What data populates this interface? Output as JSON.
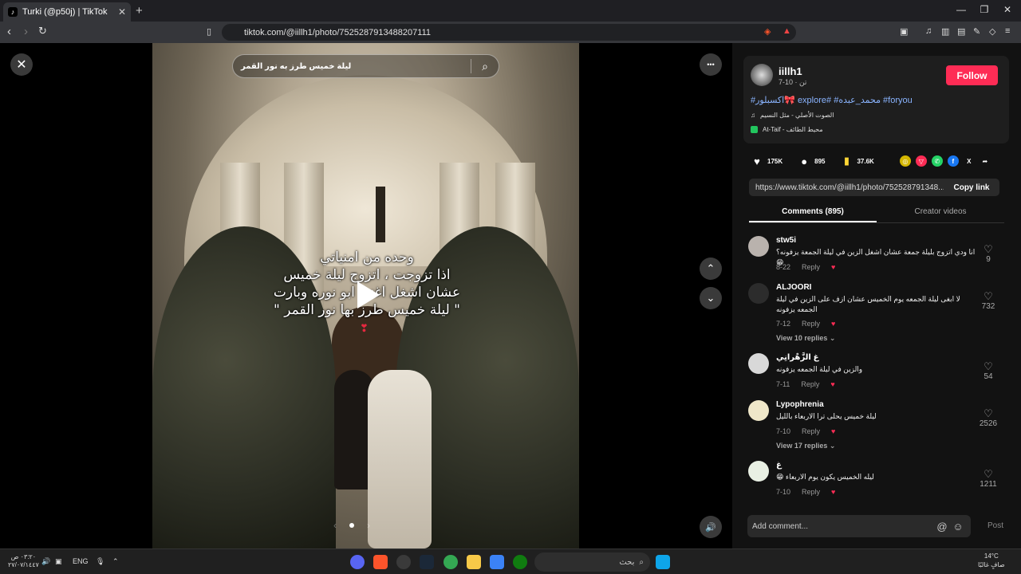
{
  "browser": {
    "tab_title": "Turki (@p50j) | TikTok",
    "tab_close": "✕",
    "new_tab": "+",
    "url": "tiktok.com/@iillh1/photo/7525287913488207111",
    "win_min": "—",
    "win_max": "❐",
    "win_close": "✕"
  },
  "viewer": {
    "search_text": "ليلة خميس طرز به نور القمر",
    "caption": "وحده من امنياتي\nاذا تزوجت ، اتزوج ليلة خميس\nعشان اشغل اغنية ابو نوره وبارت\n\" ليلة خميس طرز بها نور القمر \"",
    "heart": "❣",
    "icons": {
      "close": "✕",
      "search": "⌕",
      "more": "•••",
      "up": "⌃",
      "down": "⌄",
      "mute": "🔊",
      "prev": "‹",
      "next": "›"
    }
  },
  "post": {
    "username": "iillh1",
    "meta": "7-10 · تن",
    "follow_label": "Follow",
    "hashtags": "#اكسبلور🎀 explore# #محمد_عبده #foryou",
    "sound": "الصوت الأصلي - مثل النسيم",
    "location": "At-Taif - محيط الطائف",
    "likes": "175K",
    "comments_count": "895",
    "saves": "37.6K",
    "link": "https://www.tiktok.com/@iillh1/photo/752528791348...",
    "copy_link": "Copy link"
  },
  "tabs": {
    "comments": "Comments (895)",
    "creator": "Creator videos"
  },
  "comments": [
    {
      "user": "stw5i",
      "text": "انا ودي اتزوج بليلة جمعة عشان اشغل الزين في ليلة الجمعة يزفونه؟😁",
      "date": "8-22",
      "reply": "Reply",
      "likes": "9",
      "replies": ""
    },
    {
      "user": "ALJOORI",
      "text": "لا ابغى ليلة الجمعه يوم الخميس عشان ازف على الزين في ليلة الجمعه يزفونه",
      "date": "7-12",
      "reply": "Reply",
      "likes": "732",
      "replies": "View 10 replies ⌄"
    },
    {
      "user": "غ الزَّهْرانِي",
      "text": "والزين في ليلة الجمعه يزفونه",
      "date": "7-11",
      "reply": "Reply",
      "likes": "54",
      "replies": ""
    },
    {
      "user": "Lypophrenia",
      "text": "ليلة خميس يحلى ترا الاربعاء بالليل",
      "date": "7-10",
      "reply": "Reply",
      "likes": "2526",
      "replies": "View 17 replies ⌄"
    },
    {
      "user": "غ",
      "text": "ليله الخميس يكون يوم الاربعاء 😁",
      "date": "7-10",
      "reply": "Reply",
      "likes": "1211",
      "replies": ""
    }
  ],
  "comment_box": {
    "placeholder": "Add comment...",
    "post": "Post"
  },
  "taskbar": {
    "search_placeholder": "بحث",
    "lang": "ENG",
    "time_left": "٠٣:٢٠ ص",
    "date_left": "٢٧/٠٧/١٤٤٧",
    "weather": "14°C",
    "weather_text": "صافٍ غالبًا"
  },
  "colors": {
    "follow": "#fe2c55",
    "hashtag": "#8ab4ff",
    "panel": "#121212"
  }
}
